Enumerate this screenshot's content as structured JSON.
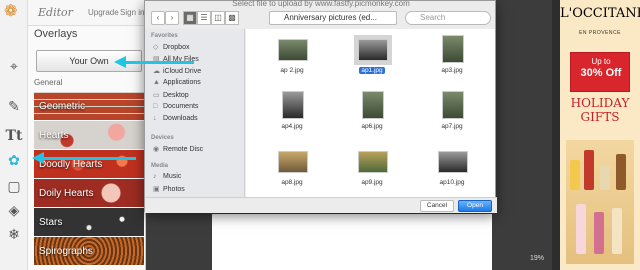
{
  "editor": {
    "brand": "Editor",
    "upgrade": "Upgrade",
    "sign_in": "Sign in"
  },
  "tools": [
    "crop-icon",
    "brush-icon",
    "text-icon",
    "butterfly-icon",
    "frame-icon",
    "texture-icon",
    "snowflake-icon"
  ],
  "overlays_panel": {
    "title": "Overlays",
    "your_own_label": "Your Own",
    "section_label": "General",
    "categories": [
      "Geometric",
      "Hearts",
      "Doodly Hearts",
      "Doily Hearts",
      "Stars",
      "Spirographs"
    ]
  },
  "dialog": {
    "title": "Select file to upload by www.fastfy.picmonkey.com",
    "folder": "Anniversary pictures (ed...",
    "search_placeholder": "Search",
    "sidebar": {
      "favorites_header": "Favorites",
      "favorites": [
        "Dropbox",
        "All My Files",
        "iCloud Drive",
        "Applications",
        "Desktop",
        "Documents",
        "Downloads"
      ],
      "devices_header": "Devices",
      "devices": [
        "Remote Disc"
      ],
      "media_header": "Media",
      "media": [
        "Music",
        "Photos"
      ]
    },
    "files": [
      "ap 2.jpg",
      "ap1.jpg",
      "ap3.jpg",
      "ap4.jpg",
      "ap6.jpg",
      "ap7.jpg",
      "ap8.jpg",
      "ap9.jpg",
      "ap10.jpg"
    ],
    "selected_file": "ap1.jpg",
    "cancel_label": "Cancel",
    "open_label": "Open"
  },
  "canvas": {
    "zoom": "19%"
  },
  "ad": {
    "brand": "L'OCCITANE",
    "sub": "EN PROVENCE",
    "up_to": "Up to",
    "percent": "30% Off",
    "line1": "HOLIDAY",
    "line2": "GIFTS"
  },
  "colors": {
    "arrow": "#20c5e6",
    "open_button": "#1b79e8",
    "ad_red": "#d9262c"
  }
}
